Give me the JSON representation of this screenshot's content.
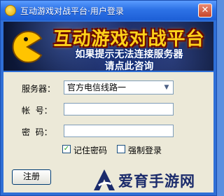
{
  "window": {
    "title": "互动游戏对战平台·用户登录",
    "close_label": "✕"
  },
  "banner": {
    "title": "互动游戏对战平台",
    "line1": "如果提示无法连接服务器",
    "line2": "请点此咨询"
  },
  "form": {
    "server_label": "服务器：",
    "server_value": "官方电信线路一",
    "account_label": "帐  号：",
    "account_value": "",
    "password_label": "密  码：",
    "password_value": "",
    "remember_label": "记住密码",
    "remember_checked": true,
    "force_label": "强制登录",
    "force_checked": false
  },
  "buttons": {
    "register": "注册"
  },
  "watermark": {
    "text": "爱育手游网"
  },
  "colors": {
    "titlebar": "#2d72e6",
    "panel": "#ece9d8",
    "banner_title": "#ffd21a"
  }
}
